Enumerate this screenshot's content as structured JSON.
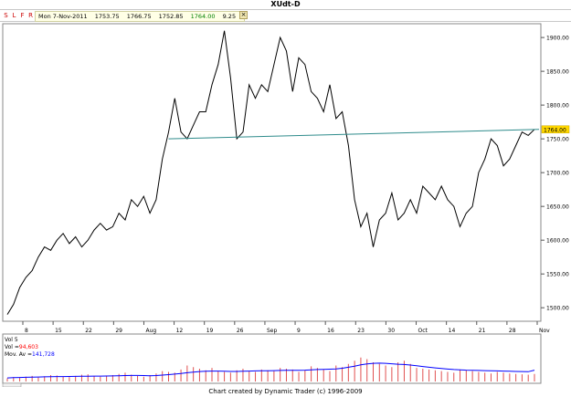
{
  "window": {
    "title": "XUdt-D"
  },
  "toolbar": {
    "buttons": [
      {
        "label": "S",
        "color": "#cc0000"
      },
      {
        "label": "L",
        "color": "#cc0000"
      },
      {
        "label": "F",
        "color": "#cc0000"
      },
      {
        "label": "R",
        "color": "#cc0000"
      }
    ],
    "date": "Mon 7-Nov-2011",
    "open": "1753.75",
    "high": "1766.75",
    "low": "1752.85",
    "close": "1764.00",
    "change": "9.25",
    "close_color": "#008000"
  },
  "price_panel": {
    "current_price_label": "1764.00",
    "y_ticks": [
      "1900.00",
      "1850.00",
      "1800.00",
      "1750.00",
      "1700.00",
      "1650.00",
      "1600.00",
      "1550.00",
      "1500.00"
    ],
    "x_ticks": [
      "8",
      "15",
      "22",
      "29",
      "Aug",
      "12",
      "19",
      "26",
      "Sep",
      "9",
      "16",
      "23",
      "30",
      "Oct",
      "14",
      "21",
      "28",
      "Nov"
    ]
  },
  "volume_panel": {
    "title": "Vol 5",
    "vol_label": "Vol =",
    "vol_value": "94,603",
    "mov_label": "Mov. Av =",
    "mov_value": "141,728",
    "vol_color": "#ff0000",
    "mov_color": "#0000ff",
    "tab_label": "Vol 5"
  },
  "footer": {
    "text": "Chart created by Dynamic Trader  (c) 1996-2009"
  },
  "chart_data": {
    "type": "line",
    "y_range": [
      1480,
      1915
    ],
    "prices": [
      1490,
      1505,
      1530,
      1545,
      1555,
      1575,
      1590,
      1585,
      1600,
      1610,
      1595,
      1605,
      1590,
      1600,
      1615,
      1625,
      1615,
      1620,
      1640,
      1630,
      1660,
      1650,
      1665,
      1640,
      1660,
      1720,
      1760,
      1810,
      1760,
      1750,
      1770,
      1790,
      1790,
      1830,
      1860,
      1910,
      1840,
      1750,
      1760,
      1830,
      1810,
      1830,
      1820,
      1860,
      1900,
      1880,
      1820,
      1870,
      1860,
      1820,
      1810,
      1790,
      1830,
      1780,
      1790,
      1740,
      1660,
      1620,
      1640,
      1590,
      1630,
      1640,
      1670,
      1630,
      1640,
      1660,
      1640,
      1680,
      1670,
      1660,
      1680,
      1660,
      1650,
      1620,
      1640,
      1650,
      1700,
      1720,
      1750,
      1740,
      1710,
      1720,
      1740,
      1760,
      1755,
      1764
    ],
    "trendline": {
      "from": 1750,
      "to": 1764
    },
    "volume_bars": [
      40,
      55,
      45,
      60,
      70,
      50,
      65,
      80,
      75,
      60,
      55,
      70,
      85,
      90,
      65,
      60,
      75,
      80,
      95,
      110,
      85,
      70,
      60,
      80,
      100,
      130,
      120,
      110,
      150,
      200,
      180,
      160,
      140,
      170,
      130,
      120,
      110,
      140,
      160,
      130,
      120,
      150,
      140,
      130,
      170,
      160,
      150,
      120,
      140,
      190,
      170,
      150,
      130,
      200,
      180,
      220,
      260,
      300,
      280,
      240,
      220,
      200,
      180,
      240,
      260,
      220,
      170,
      160,
      150,
      140,
      130,
      120,
      110,
      150,
      140,
      130,
      120,
      110,
      100,
      120,
      110,
      100,
      95,
      90,
      85,
      94.603
    ],
    "moving_average": [
      45,
      48,
      50,
      52,
      54,
      56,
      58,
      60,
      62,
      62,
      63,
      64,
      65,
      66,
      67,
      68,
      69,
      70,
      72,
      74,
      75,
      76,
      74,
      72,
      74,
      80,
      86,
      92,
      100,
      110,
      118,
      124,
      128,
      130,
      130,
      128,
      126,
      126,
      128,
      130,
      132,
      134,
      135,
      136,
      138,
      140,
      140,
      140,
      142,
      146,
      150,
      152,
      154,
      158,
      166,
      178,
      192,
      208,
      220,
      228,
      230,
      228,
      222,
      216,
      212,
      206,
      198,
      188,
      178,
      170,
      162,
      156,
      150,
      146,
      142,
      140,
      138,
      136,
      134,
      132,
      130,
      128,
      126,
      124,
      122,
      141.728
    ]
  }
}
